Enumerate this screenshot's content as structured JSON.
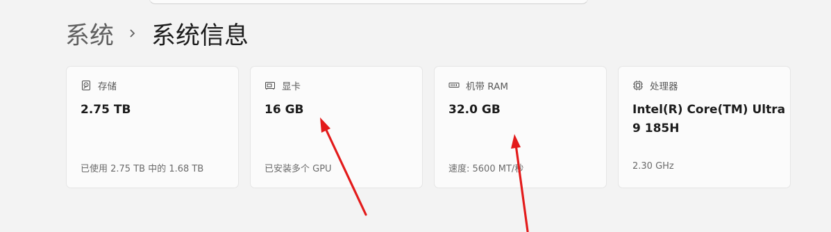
{
  "breadcrumb": {
    "parent": "系统",
    "current": "系统信息"
  },
  "cards": [
    {
      "icon": "storage-icon",
      "label": "存储",
      "value": "2.75 TB",
      "detail": "已使用 2.75 TB 中的 1.68 TB"
    },
    {
      "icon": "display-adapter-icon",
      "label": "显卡",
      "value": "16 GB",
      "detail": "已安装多个 GPU"
    },
    {
      "icon": "memory-icon",
      "label": "机带 RAM",
      "value": "32.0 GB",
      "detail": "速度: 5600 MT/秒"
    },
    {
      "icon": "processor-icon",
      "label": "处理器",
      "value": "Intel(R) Core(TM) Ultra 9 185H",
      "detail": "2.30 GHz"
    }
  ],
  "annotation_color": "#e31b1b"
}
